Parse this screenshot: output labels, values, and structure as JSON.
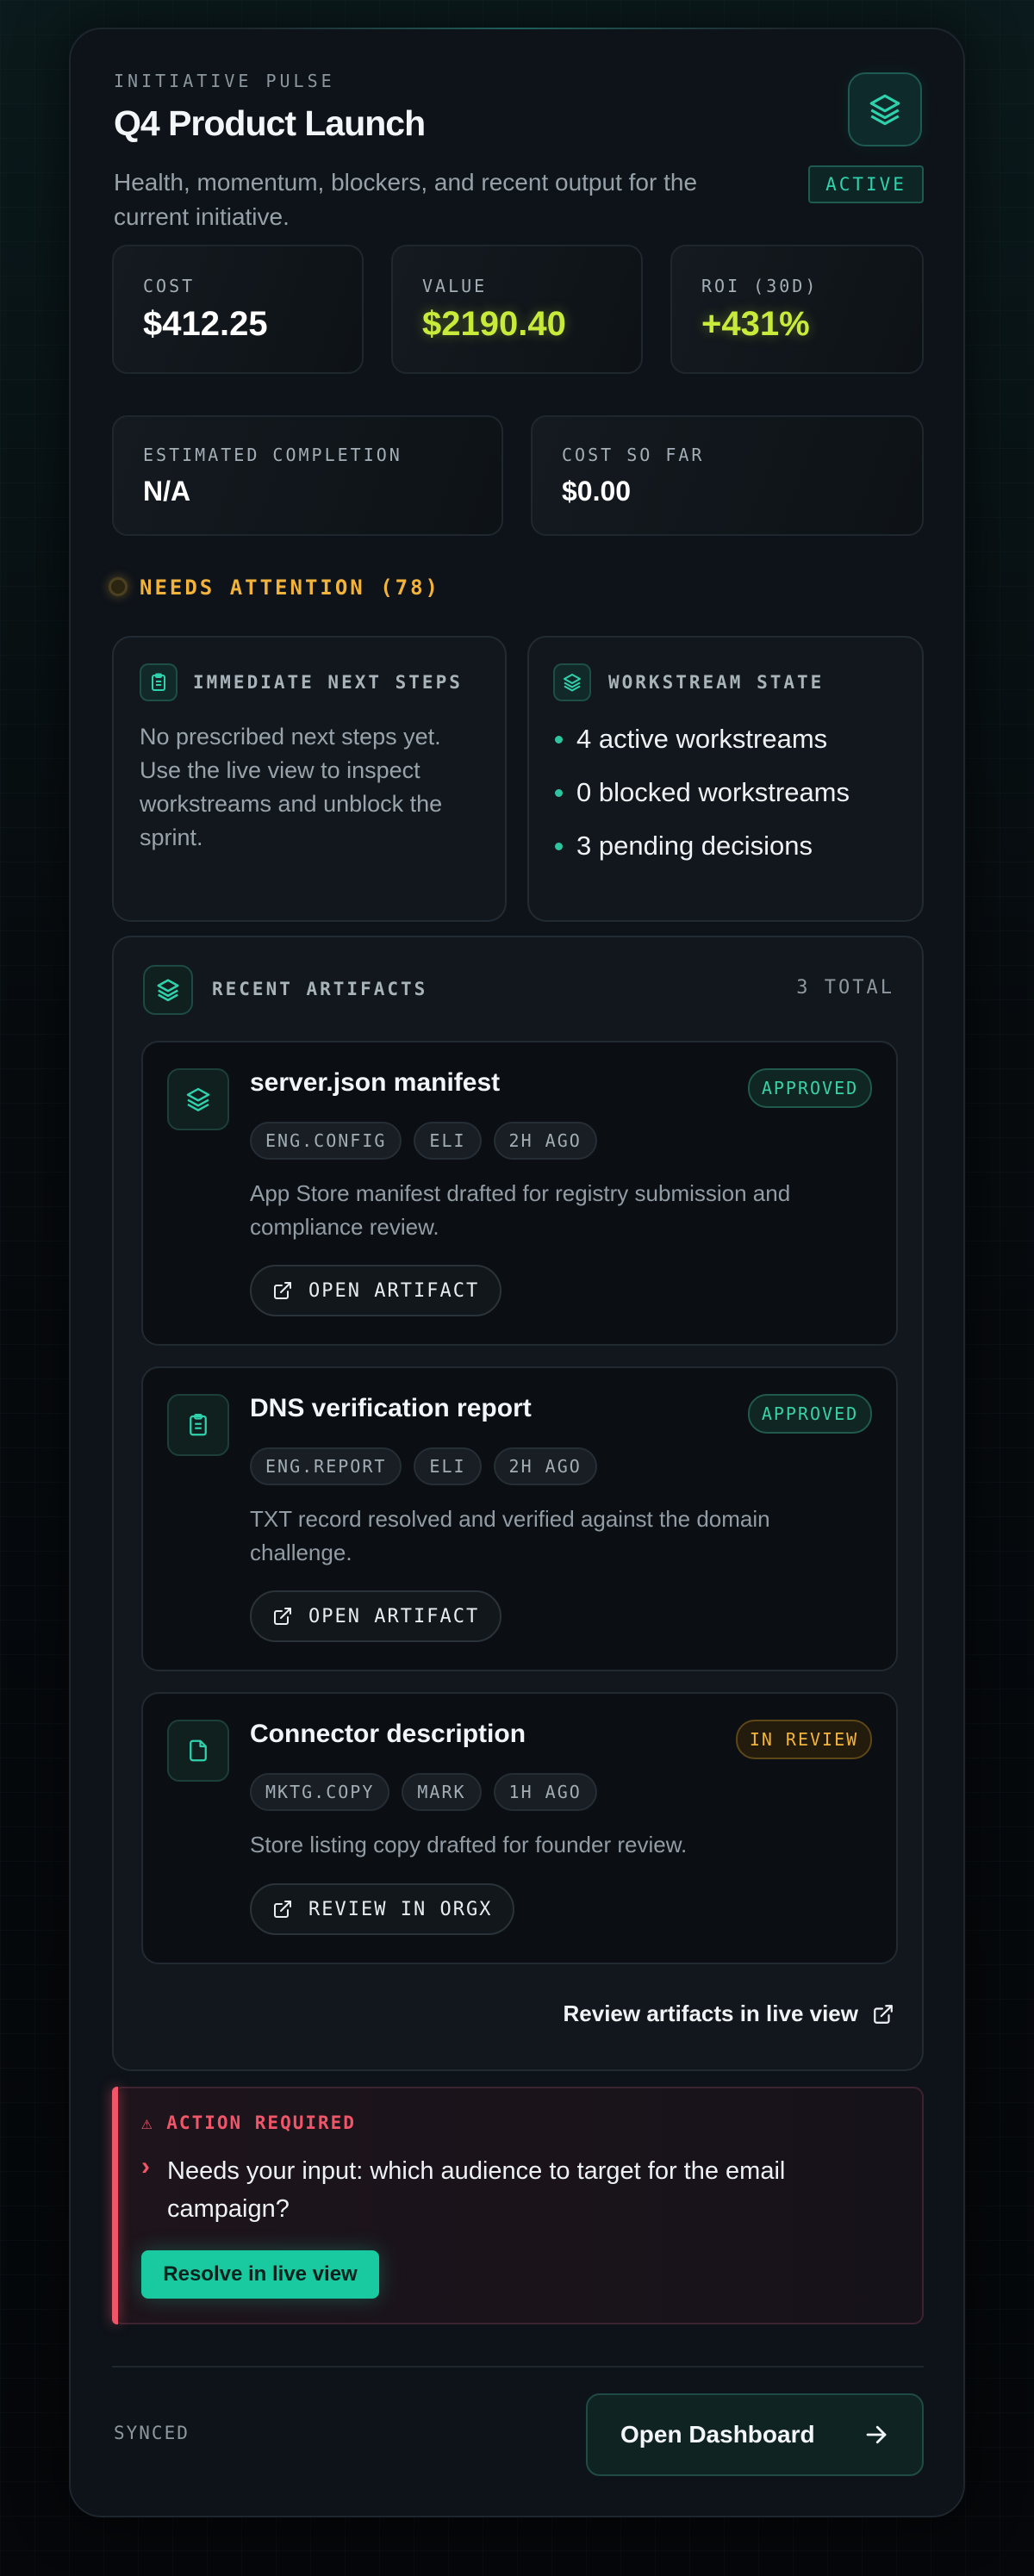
{
  "header": {
    "eyebrow": "INITIATIVE PULSE",
    "title": "Q4 Product Launch",
    "subtitle": "Health, momentum, blockers, and recent output for the current initiative.",
    "status": "ACTIVE"
  },
  "metrics": [
    {
      "label": "COST",
      "value": "$412.25",
      "color": "#ffffff"
    },
    {
      "label": "VALUE",
      "value": "$2190.40",
      "color": "#c8ea3a"
    },
    {
      "label": "ROI (30D)",
      "value": "+431%",
      "color": "#c8ea3a"
    }
  ],
  "secondary_metrics": [
    {
      "label": "ESTIMATED COMPLETION",
      "value": "N/A"
    },
    {
      "label": "COST SO FAR",
      "value": "$0.00"
    }
  ],
  "attention": {
    "label": "NEEDS ATTENTION (78)"
  },
  "next_steps": {
    "title": "IMMEDIATE NEXT STEPS",
    "icon": "clipboard-icon",
    "text": "No prescribed next steps yet. Use the live view to inspect workstreams and unblock the sprint."
  },
  "workstream": {
    "title": "WORKSTREAM STATE",
    "icon": "layers-icon",
    "items": [
      "4 active workstreams",
      "0 blocked workstreams",
      "3 pending decisions"
    ]
  },
  "artifacts": {
    "title": "RECENT ARTIFACTS",
    "total": "3 TOTAL",
    "items": [
      {
        "icon": "layers-icon",
        "title": "server.json manifest",
        "status": "APPROVED",
        "tags": [
          "ENG.CONFIG",
          "ELI",
          "2H AGO"
        ],
        "description": "App Store manifest drafted for registry submission and compliance review.",
        "action": "OPEN ARTIFACT"
      },
      {
        "icon": "clipboard-icon",
        "title": "DNS verification report",
        "status": "APPROVED",
        "tags": [
          "ENG.REPORT",
          "ELI",
          "2H AGO"
        ],
        "description": "TXT record resolved and verified against the domain challenge.",
        "action": "OPEN ARTIFACT"
      },
      {
        "icon": "document-icon",
        "title": "Connector description",
        "status": "IN REVIEW",
        "tags": [
          "MKTG.COPY",
          "MARK",
          "1H AGO"
        ],
        "description": "Store listing copy drafted for founder review.",
        "action": "REVIEW IN ORGX"
      }
    ],
    "footer_link": "Review artifacts in live view"
  },
  "action_required": {
    "title": "⚠ ACTION REQUIRED",
    "marker": "›",
    "text": "Needs your input: which audience to target for the email campaign?",
    "button": "Resolve in live view"
  },
  "footer": {
    "sync_status": "SYNCED",
    "dashboard_button": "Open Dashboard"
  },
  "colors": {
    "accent": "#19c9a0",
    "positive": "#c8ea3a",
    "warning": "#f2b33a",
    "danger": "#f0566a"
  }
}
